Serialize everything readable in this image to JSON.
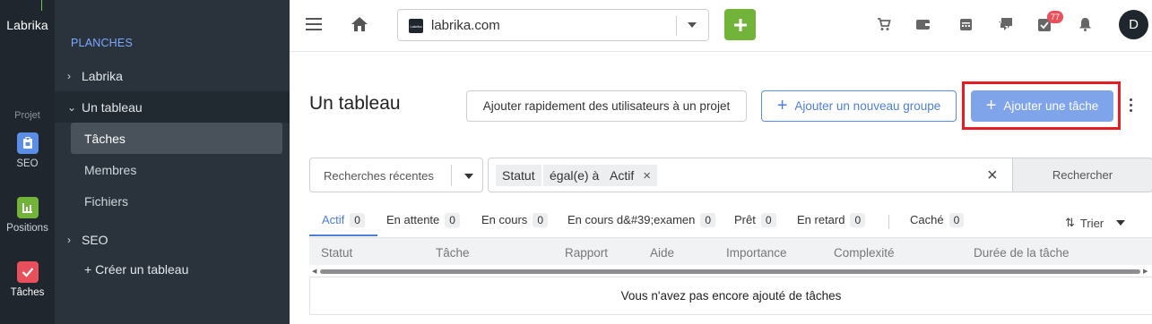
{
  "rail": {
    "logo": "Labrika",
    "section": "Projet",
    "items": [
      {
        "label": "SEO",
        "icon": "clipboard-icon",
        "color": "#5b8ee6"
      },
      {
        "label": "Positions",
        "icon": "chart-icon",
        "color": "#72b33a"
      },
      {
        "label": "Tâches",
        "icon": "check-icon",
        "color": "#e8505b"
      }
    ]
  },
  "sidebar": {
    "title": "PLANCHES",
    "groups": [
      {
        "label": "Labrika"
      },
      {
        "label": "Un tableau"
      },
      {
        "label": "SEO"
      }
    ],
    "subitems": [
      {
        "label": "Tâches"
      },
      {
        "label": "Membres"
      },
      {
        "label": "Fichiers"
      }
    ],
    "create": "+ Créer un tableau"
  },
  "topbar": {
    "site": "labrika.com",
    "favicon_text": "Labrika",
    "notif_count": "77",
    "avatar": "D"
  },
  "main": {
    "title": "Un tableau",
    "btn_quick_add": "Ajouter rapidement des utilisateurs à un projet",
    "btn_add_group": "Ajouter un nouveau groupe",
    "btn_add_task": "Ajouter une tâche"
  },
  "filter": {
    "recent": "Recherches récentes",
    "chips": [
      "Statut",
      "égal(e) à",
      "Actif"
    ],
    "search": "Rechercher"
  },
  "tabs": [
    {
      "label": "Actif",
      "count": "0"
    },
    {
      "label": "En attente",
      "count": "0"
    },
    {
      "label": "En cours",
      "count": "0"
    },
    {
      "label": "En cours d&#39;examen",
      "count": "0"
    },
    {
      "label": "Prêt",
      "count": "0"
    },
    {
      "label": "En retard",
      "count": "0"
    },
    {
      "label": "Caché",
      "count": "0"
    }
  ],
  "sort_label": "Trier",
  "table": {
    "columns": [
      "Statut",
      "Tâche",
      "Rapport",
      "Aide",
      "Importance",
      "Complexité",
      "Durée de la tâche"
    ],
    "empty": "Vous n'avez pas encore ajouté de tâches"
  },
  "colors": {
    "accent": "#4d7fd8",
    "green": "#72b33a",
    "highlight": "#e51c23"
  }
}
